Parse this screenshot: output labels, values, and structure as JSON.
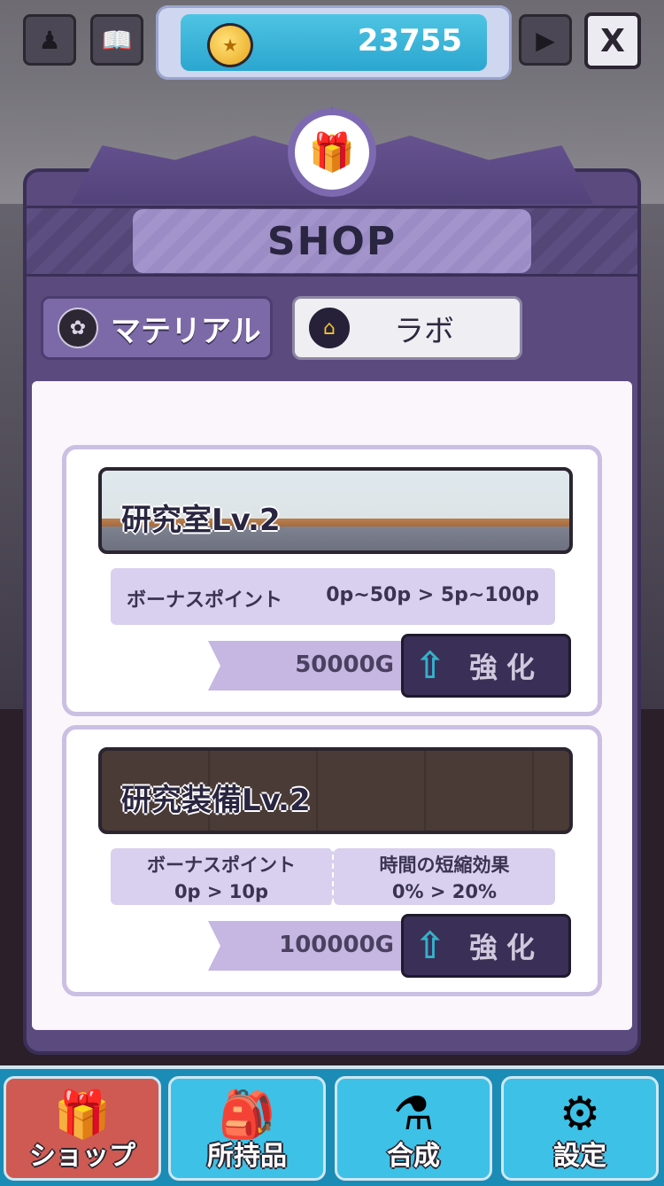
{
  "header": {
    "coins": "23755",
    "close_label": "X"
  },
  "panel": {
    "title": "SHOP",
    "tabs": [
      {
        "label": "マテリアル",
        "icon": "material-icon"
      },
      {
        "label": "ラボ",
        "icon": "lab-building-icon"
      }
    ]
  },
  "items": [
    {
      "name": "研究室Lv.2",
      "stats": {
        "label": "ボーナスポイント",
        "value": "0p~50p > 5p~100p"
      },
      "price": "50000G",
      "upgrade_label": "強化"
    },
    {
      "name": "研究装備Lv.2",
      "stats_split": [
        {
          "label": "ボーナスポイント",
          "value": "0p > 10p"
        },
        {
          "label": "時間の短縮効果",
          "value": "0% > 20%"
        }
      ],
      "price": "100000G",
      "upgrade_label": "強化"
    }
  ],
  "nav": [
    {
      "label": "ショップ",
      "icon": "shop-gift-icon",
      "active": true
    },
    {
      "label": "所持品",
      "icon": "inventory-bag-icon",
      "active": false
    },
    {
      "label": "合成",
      "icon": "synthesis-flask-icon",
      "active": false
    },
    {
      "label": "設定",
      "icon": "settings-gear-icon",
      "active": false
    }
  ],
  "colors": {
    "panel": "#5a4a7e",
    "accent_blue": "#2ba6cf",
    "nav_active": "#cf5a53"
  }
}
